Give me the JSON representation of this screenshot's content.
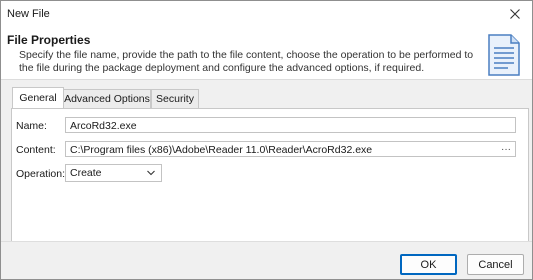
{
  "window": {
    "title": "New File",
    "close_icon": "close-icon"
  },
  "header": {
    "title": "File Properties",
    "description": "Specify the file name, provide the path to the file content, choose the operation to be performed to the file during the package deployment and configure the advanced options, if required.",
    "icon": "document-icon"
  },
  "tabs": [
    {
      "label": "General",
      "active": true
    },
    {
      "label": "Advanced Options",
      "active": false
    },
    {
      "label": "Security",
      "active": false
    }
  ],
  "form": {
    "name_label": "Name:",
    "name_value": "ArcoRd32.exe",
    "content_label": "Content:",
    "content_value": "C:\\Program files (x86)\\Adobe\\Reader 11.0\\Reader\\AcroRd32.exe",
    "browse_label": "···",
    "operation_label": "Operation:",
    "operation_value": "Create"
  },
  "buttons": {
    "ok": "OK",
    "cancel": "Cancel"
  },
  "colors": {
    "accent": "#0067c0",
    "doc_icon": "#4a7fc1"
  }
}
